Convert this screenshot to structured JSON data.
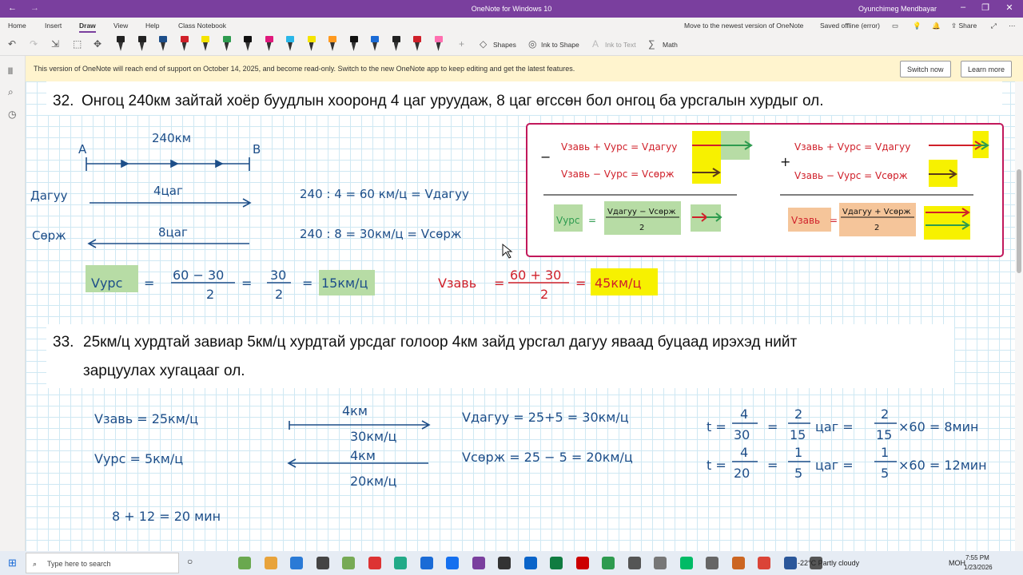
{
  "window": {
    "title": "OneNote for Windows 10",
    "user": "Oyunchimeg Mendbayar"
  },
  "menu": {
    "tabs": [
      "Home",
      "Insert",
      "Draw",
      "View",
      "Help",
      "Class Notebook"
    ],
    "active": "Draw",
    "move_link": "Move to the newest version of OneNote",
    "saved_status": "Saved offline (error)",
    "share_label": "Share"
  },
  "toolbar": {
    "shapes_label": "Shapes",
    "ink_to_shape_label": "Ink to Shape",
    "ink_to_text_label": "Ink to Text",
    "math_label": "Math",
    "pen_colors": [
      "#222222",
      "#222222",
      "#1d4e89",
      "#d0202a",
      "#f5e400",
      "#2e9b4f",
      "#111111",
      "#e0197c",
      "#2ab7e8",
      "#f5e400",
      "#ff9a1f",
      "#111111",
      "#1a6bd6",
      "#222222",
      "#d0202a",
      "#ff6fb0"
    ]
  },
  "banner": {
    "message": "This version of OneNote will reach end of support on October 14, 2025, and become read-only. Switch to the new OneNote app to keep editing and get the latest features.",
    "switch_label": "Switch now",
    "learn_label": "Learn more"
  },
  "problem32": {
    "number": "32.",
    "text": "Онгоц 240км зайтай хоёр буудлын хооронд 4 цаг уруудаж, 8 цаг өгссөн бол онгоц ба урсгалын хурдыг ол.",
    "diagram": {
      "distance": "240км",
      "point_a": "A",
      "point_b": "B",
      "label_down": "Дагуу",
      "label_down_time": "4цаг",
      "label_up": "Сөрж",
      "label_up_time": "8цаг"
    },
    "eq1": "240 : 4 = 60 км/ц = Vдагуу",
    "eq2": "240 : 8 = 30км/ц = Vсөрж",
    "v_urs_label": "Vурс",
    "v_urs_num1": "60 − 30",
    "v_urs_den1": "2",
    "v_urs_num2": "30",
    "v_urs_den2": "2",
    "v_urs_result": "15км/ц",
    "v_zav_label": "Vзавь",
    "v_zav_num": "60 + 30",
    "v_zav_den": "2",
    "v_zav_result": "45км/ц",
    "box": {
      "minus": "−",
      "plus": "+",
      "r1": "Vзавь + Vурс = Vдагуу",
      "r2": "Vзавь − Vурс = Vсөрж",
      "formula_left_label": "Vурс",
      "formula_left_num": "Vдагуу − Vсөрж",
      "formula_left_den": "2",
      "formula_right_label": "Vзавь",
      "formula_right_num": "Vдагуу + Vсөрж",
      "formula_right_den": "2"
    }
  },
  "problem33": {
    "number": "33.",
    "line1": "25км/ц хурдтай завиар 5км/ц хурдтай урсдаг голоор 4км зайд урсгал дагуу яваад буцаад ирэхэд нийт",
    "line2": "зарцуулах хугацааг ол.",
    "v_zav": "Vзавь = 25км/ц",
    "v_urs": "Vурс = 5км/ц",
    "arrow1_top": "4км",
    "arrow1_bot": "30км/ц",
    "arrow2_top": "4км",
    "arrow2_bot": "20км/ц",
    "v_dagu": "Vдагуу = 25+5 = 30км/ц",
    "v_sorj": "Vсөрж = 25 − 5 = 20км/ц",
    "t1": {
      "t": "t =",
      "n1": "4",
      "d1": "30",
      "eq": "=",
      "n2": "2",
      "d2": "15",
      "unit": "цаг =",
      "n3": "2",
      "d3": "15",
      "tail": "×60 = 8мин"
    },
    "t2": {
      "t": "t =",
      "n1": "4",
      "d1": "20",
      "eq": "=",
      "n2": "1",
      "d2": "5",
      "unit": "цаг =",
      "n3": "1",
      "d3": "5",
      "tail": "×60 = 12мин"
    },
    "total": "8 + 12 = 20 мин"
  },
  "taskbar": {
    "search_placeholder": "Type here to search",
    "weather": "-22°C  Partly cloudy",
    "lang": "МОН",
    "time": "7:55 PM",
    "date": "1/23/2026"
  }
}
